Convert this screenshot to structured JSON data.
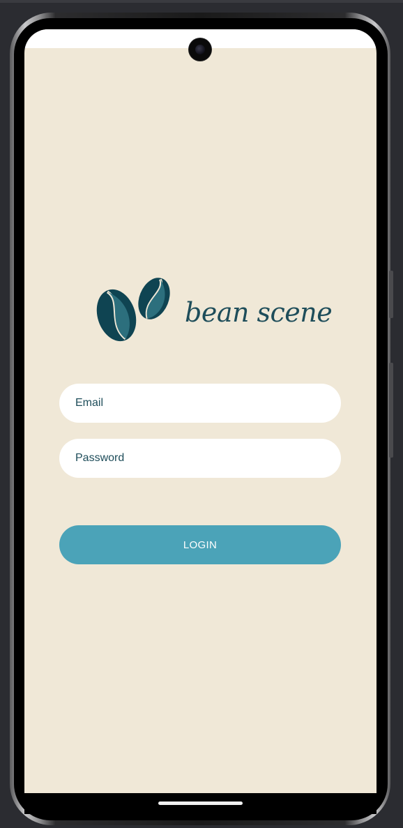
{
  "app": {
    "name": "bean scene",
    "brand_color": "#1e4d5a",
    "background_color": "#f0e8d7",
    "accent_color": "#4ba3b8"
  },
  "logo": {
    "icon": "coffee-beans-icon",
    "text": "bean scene"
  },
  "form": {
    "email": {
      "placeholder": "Email",
      "value": ""
    },
    "password": {
      "placeholder": "Password",
      "value": ""
    },
    "login_label": "LOGIN"
  }
}
